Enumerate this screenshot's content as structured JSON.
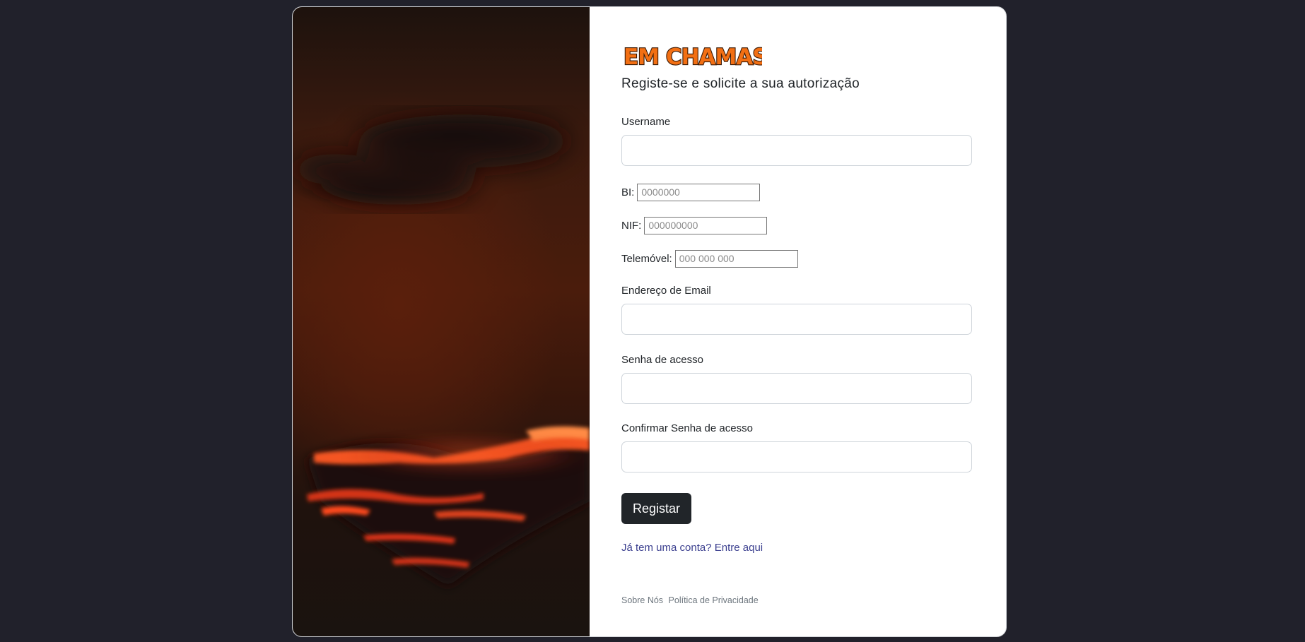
{
  "brand": {
    "logo_text": "EM CHAMAS",
    "logo_fill": "#f26f13",
    "logo_outline": "#3a1a06"
  },
  "header": {
    "subtitle": "Registe-se e solicite a sua autorização"
  },
  "form": {
    "username_label": "Username",
    "bi_label": "BI:",
    "bi_placeholder": "0000000",
    "nif_label": "NIF:",
    "nif_placeholder": "000000000",
    "telemovel_label": "Telemóvel:",
    "telemovel_placeholder": "000 000 000",
    "email_label": "Endereço de Email",
    "password_label": "Senha de acesso",
    "confirm_password_label": "Confirmar Senha de acesso",
    "submit_label": "Registar"
  },
  "links": {
    "login_link": "Já tem uma conta? Entre aqui"
  },
  "footer": {
    "about": "Sobre Nós",
    "privacy": "Política de Privacidade"
  },
  "image": {
    "description_icon": "fire-sky-image"
  }
}
